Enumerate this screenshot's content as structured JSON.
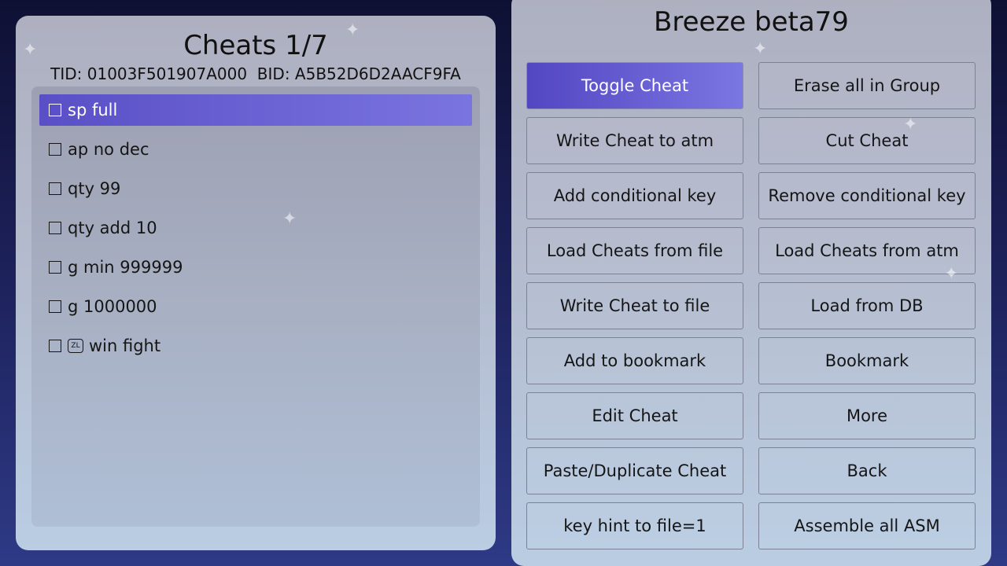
{
  "left_panel": {
    "title": "Cheats 1/7",
    "ids": "TID: 01003F501907A000  BID: A5B52D6D2AACF9FA",
    "items": [
      {
        "label": "sp full",
        "selected": true
      },
      {
        "label": "ap no dec",
        "selected": false
      },
      {
        "label": "qty 99",
        "selected": false
      },
      {
        "label": "qty add 10",
        "selected": false
      },
      {
        "label": "g min 999999",
        "selected": false
      },
      {
        "label": "g 1000000",
        "selected": false
      },
      {
        "label": "win fight",
        "selected": false,
        "key_icon": "zl-button-icon",
        "key_text": "ZL"
      }
    ]
  },
  "right_panel": {
    "title": "Breeze beta79",
    "buttons": [
      {
        "label": "Toggle Cheat",
        "selected": true
      },
      {
        "label": "Erase all in Group"
      },
      {
        "label": "Write Cheat to atm"
      },
      {
        "label": "Cut Cheat"
      },
      {
        "label": "Add conditional key"
      },
      {
        "label": "Remove conditional key"
      },
      {
        "label": "Load Cheats from file"
      },
      {
        "label": "Load Cheats from atm"
      },
      {
        "label": "Write Cheat to file"
      },
      {
        "label": "Load from DB"
      },
      {
        "label": "Add to bookmark"
      },
      {
        "label": "Bookmark"
      },
      {
        "label": "Edit Cheat"
      },
      {
        "label": "More"
      },
      {
        "label": "Paste/Duplicate Cheat"
      },
      {
        "label": "Back"
      },
      {
        "label": "key hint to file=1"
      },
      {
        "label": "Assemble all ASM"
      }
    ]
  },
  "colors": {
    "accent_start": "#5446c2",
    "accent_end": "#7a76e2",
    "background_top": "#0e1033",
    "background_bottom": "#2e3a86"
  },
  "icons": {
    "checkbox": "checkbox-empty-icon",
    "sparkle": "sparkle-icon"
  }
}
